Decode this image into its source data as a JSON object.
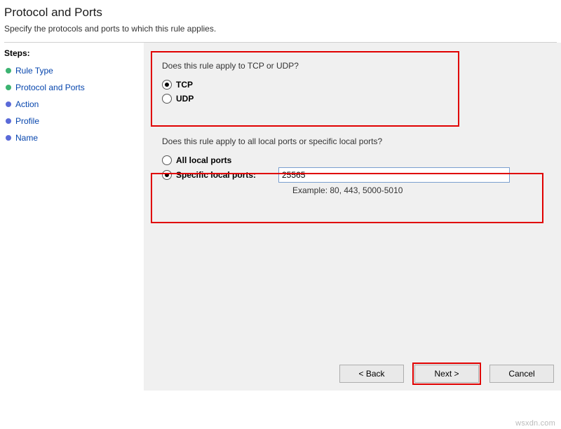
{
  "header": {
    "title": "Protocol and Ports",
    "subtitle": "Specify the protocols and ports to which this rule applies."
  },
  "sidebar": {
    "heading": "Steps:",
    "items": [
      {
        "label": "Rule Type",
        "state": "done"
      },
      {
        "label": "Protocol and Ports",
        "state": "current"
      },
      {
        "label": "Action",
        "state": "future"
      },
      {
        "label": "Profile",
        "state": "future"
      },
      {
        "label": "Name",
        "state": "future"
      }
    ]
  },
  "content": {
    "q1": "Does this rule apply to TCP or UDP?",
    "protocol": {
      "tcp": "TCP",
      "udp": "UDP",
      "selected": "tcp"
    },
    "q2": "Does this rule apply to all local ports or specific local ports?",
    "ports": {
      "all_label": "All local ports",
      "specific_label": "Specific local ports:",
      "selected": "specific",
      "value": "25565",
      "example": "Example: 80, 443, 5000-5010"
    }
  },
  "footer": {
    "back": "< Back",
    "next": "Next >",
    "cancel": "Cancel"
  },
  "watermark": "wsxdn.com"
}
